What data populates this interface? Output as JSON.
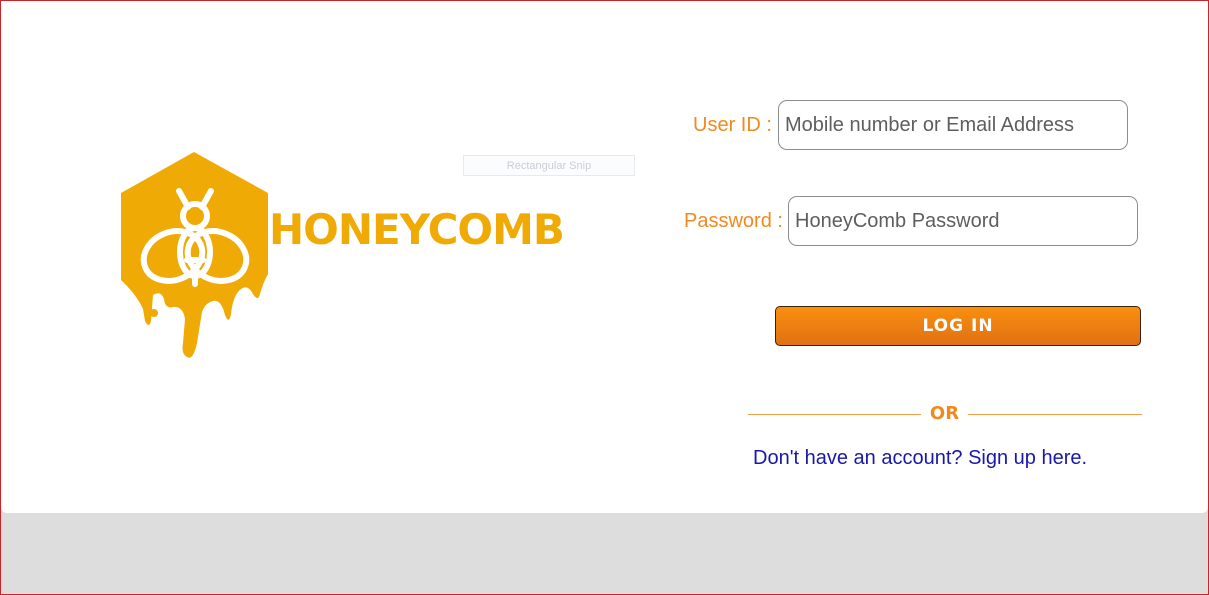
{
  "brand": {
    "name": "HONEYCOMB",
    "logo_icon": "honeycomb-bee-icon",
    "color": "#efaa05"
  },
  "overlay": {
    "snip_label": "Rectangular Snip"
  },
  "login": {
    "user_id_label": "User ID :",
    "user_id_placeholder": "Mobile number or Email Address",
    "password_label": "Password :",
    "password_placeholder": "HoneyComb Password",
    "login_button": "LOG IN",
    "or_text": "OR",
    "signup_link": "Don't have an account? Sign up here."
  },
  "colors": {
    "accent": "#f08a1f",
    "button": "#f98f10",
    "link": "#1a17ad",
    "border": "#c8242b"
  }
}
